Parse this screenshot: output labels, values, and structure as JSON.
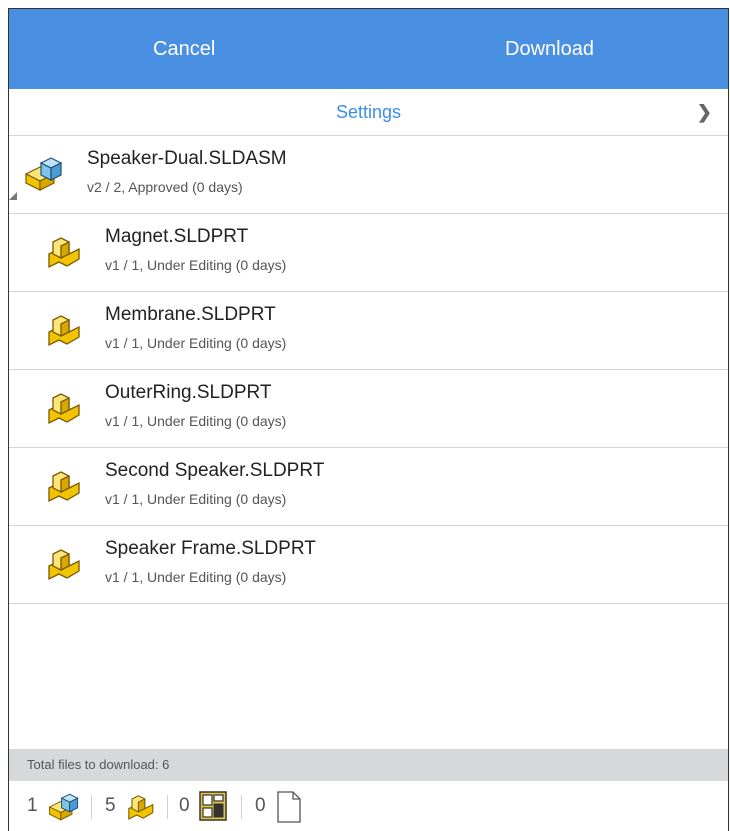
{
  "toolbar": {
    "cancel_label": "Cancel",
    "download_label": "Download"
  },
  "settings": {
    "label": "Settings",
    "chevron": "❯"
  },
  "root_item": {
    "name": "Speaker-Dual.SLDASM",
    "meta": "v2 / 2, Approved (0 days)",
    "icon": "assembly-icon"
  },
  "items": [
    {
      "name": "Magnet.SLDPRT",
      "meta": "v1 / 1, Under Editing (0 days)",
      "icon": "part-icon"
    },
    {
      "name": "Membrane.SLDPRT",
      "meta": "v1 / 1, Under Editing (0 days)",
      "icon": "part-icon"
    },
    {
      "name": "OuterRing.SLDPRT",
      "meta": "v1 / 1, Under Editing (0 days)",
      "icon": "part-icon"
    },
    {
      "name": "Second Speaker.SLDPRT",
      "meta": "v1 / 1, Under Editing (0 days)",
      "icon": "part-icon"
    },
    {
      "name": "Speaker Frame.SLDPRT",
      "meta": "v1 / 1, Under Editing (0 days)",
      "icon": "part-icon"
    }
  ],
  "footer": {
    "total_label": "Total files to download: 6",
    "counts": [
      {
        "value": "1",
        "icon": "assembly-icon"
      },
      {
        "value": "5",
        "icon": "part-icon"
      },
      {
        "value": "0",
        "icon": "drawing-icon"
      },
      {
        "value": "0",
        "icon": "document-icon"
      }
    ]
  },
  "colors": {
    "accent": "#4a90e2",
    "link": "#3a8ee6",
    "part_yellow": "#f2c400",
    "assembly_blue": "#5aa9d8"
  }
}
